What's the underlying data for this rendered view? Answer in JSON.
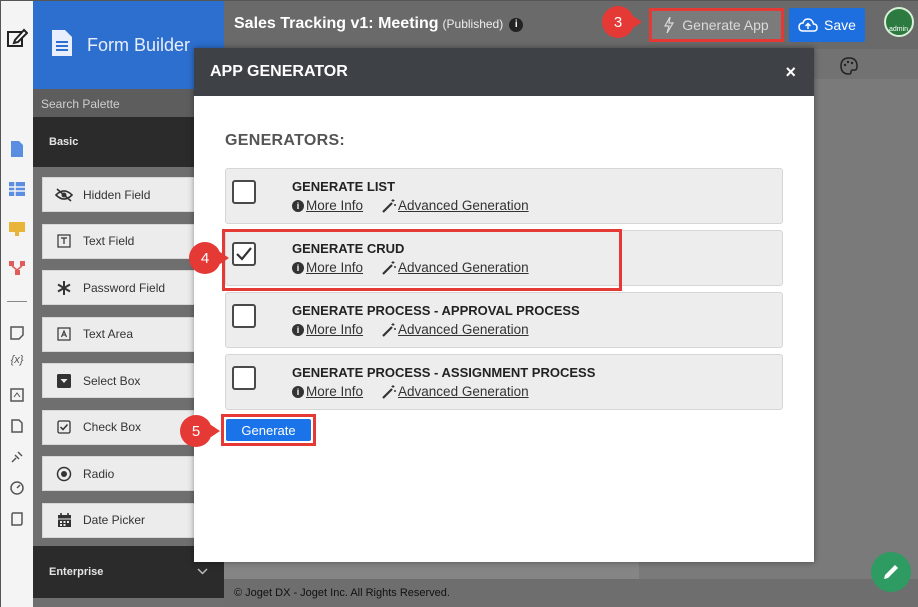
{
  "rail_icons": [
    "edit-icon",
    "form-icon",
    "datalist-icon",
    "userview-icon",
    "process-icon",
    "page-icon",
    "variable-icon",
    "plugin-icon",
    "document-icon",
    "connector-icon",
    "gauge-icon",
    "scroll-icon"
  ],
  "sidebar": {
    "title": "Form Builder",
    "search_placeholder": "Search Palette",
    "basic_group": "Basic",
    "items": [
      {
        "label": "Hidden Field",
        "icon": "eye-slash-icon"
      },
      {
        "label": "Text Field",
        "icon": "text-field-icon"
      },
      {
        "label": "Password Field",
        "icon": "asterisk-icon"
      },
      {
        "label": "Text Area",
        "icon": "text-area-icon"
      },
      {
        "label": "Select Box",
        "icon": "select-box-icon"
      },
      {
        "label": "Check Box",
        "icon": "check-box-icon"
      },
      {
        "label": "Radio",
        "icon": "radio-icon"
      },
      {
        "label": "Date Picker",
        "icon": "calendar-icon"
      }
    ],
    "enterprise_group": "Enterprise"
  },
  "topbar": {
    "app_title": "Sales Tracking v1: Meeting",
    "status": "(Published)",
    "generate_app_label": "Generate App",
    "save_label": "Save",
    "avatar_label": "admin"
  },
  "steps": {
    "s3": "3",
    "s4": "4",
    "s5": "5"
  },
  "modal": {
    "title": "APP GENERATOR",
    "close": "×",
    "generators_label": "GENERATORS:",
    "more_info": "More Info",
    "advanced": "Advanced Generation",
    "generators": [
      {
        "name": "GENERATE LIST",
        "checked": false
      },
      {
        "name": "GENERATE CRUD",
        "checked": true
      },
      {
        "name": "GENERATE PROCESS - APPROVAL PROCESS",
        "checked": false
      },
      {
        "name": "GENERATE PROCESS - ASSIGNMENT PROCESS",
        "checked": false
      }
    ],
    "generate_label": "Generate"
  },
  "footer": "© Joget DX - Joget Inc. All Rights Reserved.",
  "colors": {
    "highlight": "#e53935",
    "primary": "#1a73e8",
    "header": "#2d6fcf"
  }
}
